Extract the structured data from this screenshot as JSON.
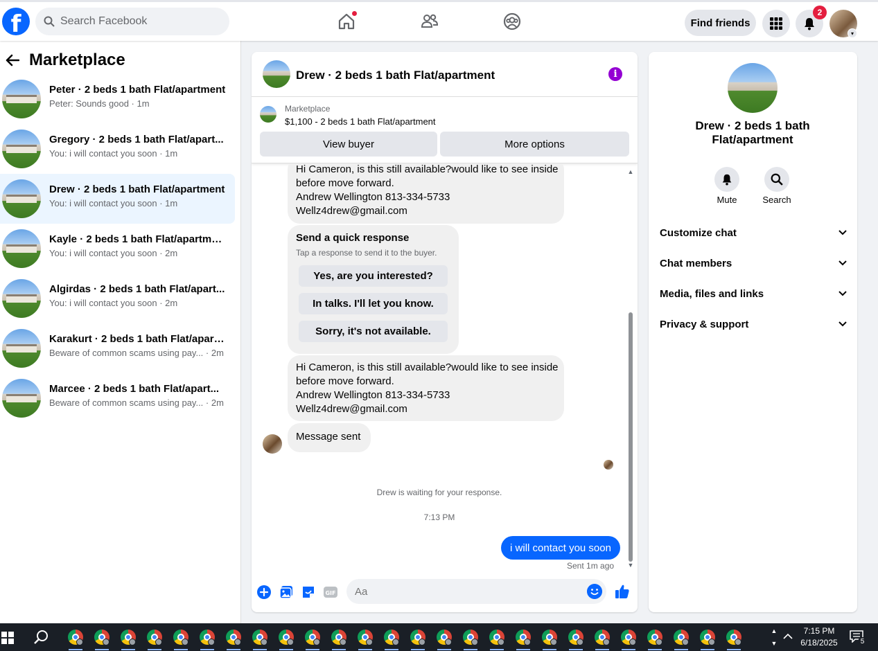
{
  "colors": {
    "brand": "#0866ff",
    "notify": "#e41e3f",
    "info": "#9400d3"
  },
  "topbar": {
    "logo": "f",
    "search_placeholder": "Search Facebook",
    "find_friends": "Find friends",
    "notification_count": "2"
  },
  "sidebar": {
    "title": "Marketplace",
    "conversations": [
      {
        "name": "Peter · 2 beds 1 bath Flat/apartment",
        "preview": "Peter: Sounds good · 1m"
      },
      {
        "name": "Gregory · 2 beds 1 bath Flat/apart...",
        "preview": "You: i will contact you soon · 1m"
      },
      {
        "name": "Drew · 2 beds 1 bath Flat/apartment",
        "preview": "You: i will contact you soon · 1m"
      },
      {
        "name": "Kayle · 2 beds 1 bath Flat/apartment",
        "preview": "You: i will contact you soon · 2m"
      },
      {
        "name": "Algirdas · 2 beds 1 bath Flat/apart...",
        "preview": "You: i will contact you soon · 2m"
      },
      {
        "name": "Karakurt · 2 beds 1 bath Flat/apart...",
        "preview": "Beware of common scams using pay... · 2m"
      },
      {
        "name": "Marcee · 2 beds 1 bath Flat/apart...",
        "preview": "Beware of common scams using pay... · 2m"
      }
    ]
  },
  "chat": {
    "title": "Drew · 2 beds 1 bath Flat/apartment",
    "marketplace_label": "Marketplace",
    "listing": "$1,100 - 2 beds 1 bath Flat/apartment",
    "view_buyer": "View buyer",
    "more_options": "More options",
    "message1": {
      "lines": [
        "Hi Cameron, is this still available?would like to see inside",
        "before move forward.",
        "Andrew Wellington 813-334-5733",
        "Wellz4drew@gmail.com"
      ]
    },
    "quick_response": {
      "title": "Send a quick response",
      "subtitle": "Tap a response to send it to the buyer.",
      "options": [
        "Yes, are you interested?",
        "In talks. I'll let you know.",
        "Sorry, it's not available."
      ]
    },
    "message2": {
      "lines": [
        "Hi Cameron, is this still available?would like to see inside",
        "before move forward.",
        "Andrew Wellington 813-334-5733",
        "Wellz4drew@gmail.com"
      ]
    },
    "message_sent": "Message sent",
    "waiting": "Drew is waiting for your response.",
    "time": "7:13 PM",
    "outgoing": "i will contact you soon",
    "sent_status": "Sent 1m ago",
    "composer_placeholder": "Aa"
  },
  "info_panel": {
    "title": "Drew · 2 beds 1 bath Flat/apartment",
    "mute": "Mute",
    "search": "Search",
    "sections": [
      "Customize chat",
      "Chat members",
      "Media, files and links",
      "Privacy & support"
    ]
  },
  "taskbar": {
    "time": "7:15 PM",
    "date": "6/18/2025",
    "notifications": "5"
  }
}
